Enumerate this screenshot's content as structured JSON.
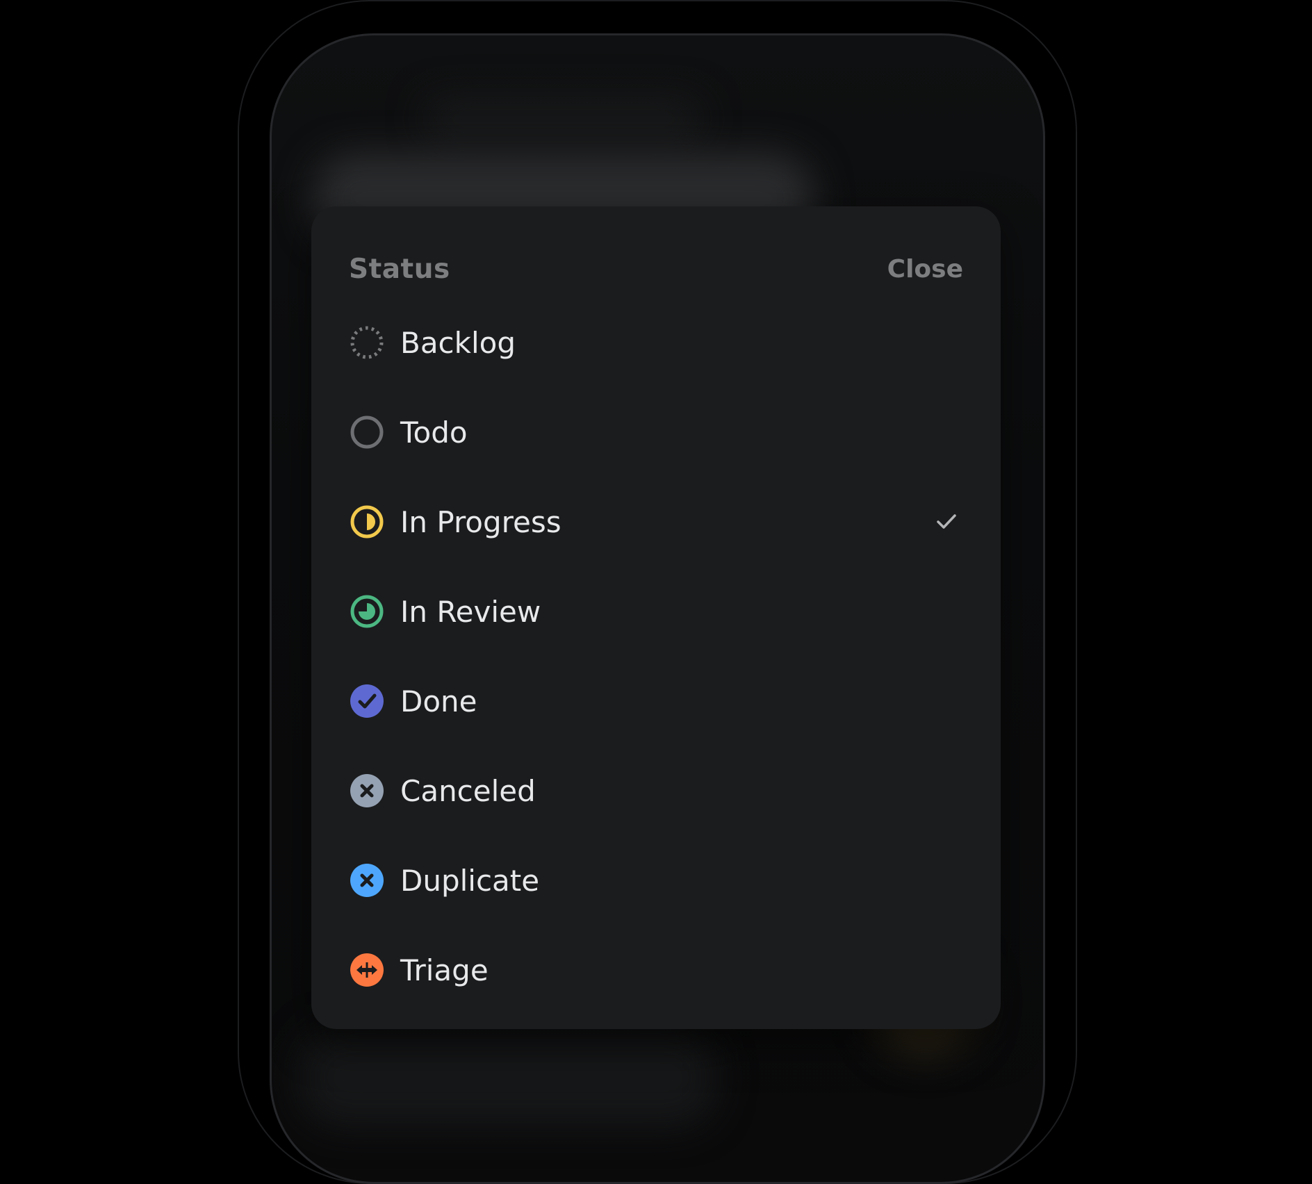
{
  "sheet": {
    "title": "Status",
    "close_label": "Close"
  },
  "statuses": [
    {
      "label": "Backlog",
      "icon": "backlog-dotted-circle-icon",
      "color": "#7a7b7d",
      "selected": false
    },
    {
      "label": "Todo",
      "icon": "todo-circle-icon",
      "color": "#6e6f72",
      "selected": false
    },
    {
      "label": "In Progress",
      "icon": "in-progress-half-circle-icon",
      "color": "#f2c94c",
      "selected": true
    },
    {
      "label": "In Review",
      "icon": "in-review-circle-icon",
      "color": "#4cb782",
      "selected": false
    },
    {
      "label": "Done",
      "icon": "done-check-circle-icon",
      "color": "#5e6ad2",
      "selected": false
    },
    {
      "label": "Canceled",
      "icon": "canceled-x-circle-icon",
      "color": "#95a2b3",
      "selected": false
    },
    {
      "label": "Duplicate",
      "icon": "duplicate-x-circle-icon",
      "color": "#4ea7fc",
      "selected": false
    },
    {
      "label": "Triage",
      "icon": "triage-arrows-circle-icon",
      "color": "#fc7840",
      "selected": false
    }
  ],
  "colors": {
    "background": "#000000",
    "sheet": "#1b1c1e",
    "text": "#e8e9ea",
    "muted": "#7d7e80",
    "checkmark": "#b5b6b8"
  }
}
